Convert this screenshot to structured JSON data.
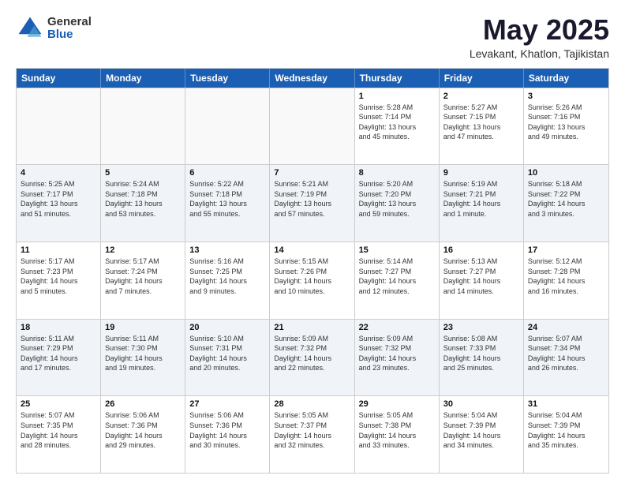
{
  "logo": {
    "general": "General",
    "blue": "Blue"
  },
  "header": {
    "month": "May 2025",
    "location": "Levakant, Khatlon, Tajikistan"
  },
  "weekdays": [
    "Sunday",
    "Monday",
    "Tuesday",
    "Wednesday",
    "Thursday",
    "Friday",
    "Saturday"
  ],
  "rows": [
    [
      {
        "day": "",
        "info": "",
        "empty": true
      },
      {
        "day": "",
        "info": "",
        "empty": true
      },
      {
        "day": "",
        "info": "",
        "empty": true
      },
      {
        "day": "",
        "info": "",
        "empty": true
      },
      {
        "day": "1",
        "info": "Sunrise: 5:28 AM\nSunset: 7:14 PM\nDaylight: 13 hours\nand 45 minutes."
      },
      {
        "day": "2",
        "info": "Sunrise: 5:27 AM\nSunset: 7:15 PM\nDaylight: 13 hours\nand 47 minutes."
      },
      {
        "day": "3",
        "info": "Sunrise: 5:26 AM\nSunset: 7:16 PM\nDaylight: 13 hours\nand 49 minutes."
      }
    ],
    [
      {
        "day": "4",
        "info": "Sunrise: 5:25 AM\nSunset: 7:17 PM\nDaylight: 13 hours\nand 51 minutes."
      },
      {
        "day": "5",
        "info": "Sunrise: 5:24 AM\nSunset: 7:18 PM\nDaylight: 13 hours\nand 53 minutes."
      },
      {
        "day": "6",
        "info": "Sunrise: 5:22 AM\nSunset: 7:18 PM\nDaylight: 13 hours\nand 55 minutes."
      },
      {
        "day": "7",
        "info": "Sunrise: 5:21 AM\nSunset: 7:19 PM\nDaylight: 13 hours\nand 57 minutes."
      },
      {
        "day": "8",
        "info": "Sunrise: 5:20 AM\nSunset: 7:20 PM\nDaylight: 13 hours\nand 59 minutes."
      },
      {
        "day": "9",
        "info": "Sunrise: 5:19 AM\nSunset: 7:21 PM\nDaylight: 14 hours\nand 1 minute."
      },
      {
        "day": "10",
        "info": "Sunrise: 5:18 AM\nSunset: 7:22 PM\nDaylight: 14 hours\nand 3 minutes."
      }
    ],
    [
      {
        "day": "11",
        "info": "Sunrise: 5:17 AM\nSunset: 7:23 PM\nDaylight: 14 hours\nand 5 minutes."
      },
      {
        "day": "12",
        "info": "Sunrise: 5:17 AM\nSunset: 7:24 PM\nDaylight: 14 hours\nand 7 minutes."
      },
      {
        "day": "13",
        "info": "Sunrise: 5:16 AM\nSunset: 7:25 PM\nDaylight: 14 hours\nand 9 minutes."
      },
      {
        "day": "14",
        "info": "Sunrise: 5:15 AM\nSunset: 7:26 PM\nDaylight: 14 hours\nand 10 minutes."
      },
      {
        "day": "15",
        "info": "Sunrise: 5:14 AM\nSunset: 7:27 PM\nDaylight: 14 hours\nand 12 minutes."
      },
      {
        "day": "16",
        "info": "Sunrise: 5:13 AM\nSunset: 7:27 PM\nDaylight: 14 hours\nand 14 minutes."
      },
      {
        "day": "17",
        "info": "Sunrise: 5:12 AM\nSunset: 7:28 PM\nDaylight: 14 hours\nand 16 minutes."
      }
    ],
    [
      {
        "day": "18",
        "info": "Sunrise: 5:11 AM\nSunset: 7:29 PM\nDaylight: 14 hours\nand 17 minutes."
      },
      {
        "day": "19",
        "info": "Sunrise: 5:11 AM\nSunset: 7:30 PM\nDaylight: 14 hours\nand 19 minutes."
      },
      {
        "day": "20",
        "info": "Sunrise: 5:10 AM\nSunset: 7:31 PM\nDaylight: 14 hours\nand 20 minutes."
      },
      {
        "day": "21",
        "info": "Sunrise: 5:09 AM\nSunset: 7:32 PM\nDaylight: 14 hours\nand 22 minutes."
      },
      {
        "day": "22",
        "info": "Sunrise: 5:09 AM\nSunset: 7:32 PM\nDaylight: 14 hours\nand 23 minutes."
      },
      {
        "day": "23",
        "info": "Sunrise: 5:08 AM\nSunset: 7:33 PM\nDaylight: 14 hours\nand 25 minutes."
      },
      {
        "day": "24",
        "info": "Sunrise: 5:07 AM\nSunset: 7:34 PM\nDaylight: 14 hours\nand 26 minutes."
      }
    ],
    [
      {
        "day": "25",
        "info": "Sunrise: 5:07 AM\nSunset: 7:35 PM\nDaylight: 14 hours\nand 28 minutes."
      },
      {
        "day": "26",
        "info": "Sunrise: 5:06 AM\nSunset: 7:36 PM\nDaylight: 14 hours\nand 29 minutes."
      },
      {
        "day": "27",
        "info": "Sunrise: 5:06 AM\nSunset: 7:36 PM\nDaylight: 14 hours\nand 30 minutes."
      },
      {
        "day": "28",
        "info": "Sunrise: 5:05 AM\nSunset: 7:37 PM\nDaylight: 14 hours\nand 32 minutes."
      },
      {
        "day": "29",
        "info": "Sunrise: 5:05 AM\nSunset: 7:38 PM\nDaylight: 14 hours\nand 33 minutes."
      },
      {
        "day": "30",
        "info": "Sunrise: 5:04 AM\nSunset: 7:39 PM\nDaylight: 14 hours\nand 34 minutes."
      },
      {
        "day": "31",
        "info": "Sunrise: 5:04 AM\nSunset: 7:39 PM\nDaylight: 14 hours\nand 35 minutes."
      }
    ]
  ]
}
